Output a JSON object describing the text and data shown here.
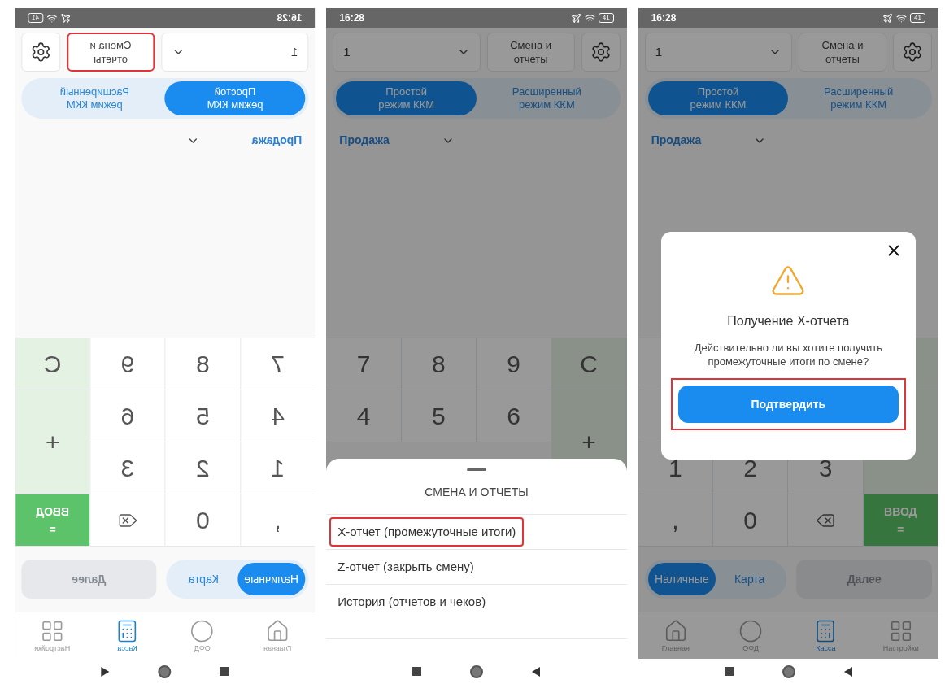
{
  "screens": [
    {
      "mirrored": true,
      "dimmed": false,
      "status_bar": {
        "time": "16:28",
        "battery": "41"
      },
      "shift_select": {
        "value": "1"
      },
      "shift_button": {
        "label": "Смена и отчеты",
        "highlighted": true
      },
      "modes": [
        {
          "label": "Расширенный режим ККМ",
          "selected": false
        },
        {
          "label": "Простой режим ККМ",
          "selected": true
        }
      ],
      "operation": "Продажа",
      "keypad": [
        {
          "kind": "clear",
          "label": "C"
        },
        {
          "kind": "digit",
          "label": "9"
        },
        {
          "kind": "digit",
          "label": "8"
        },
        {
          "kind": "digit",
          "label": "7"
        },
        {
          "kind": "plus",
          "label": "+"
        },
        {
          "kind": "digit",
          "label": "6"
        },
        {
          "kind": "digit",
          "label": "5"
        },
        {
          "kind": "digit",
          "label": "4"
        },
        {
          "kind": "digit",
          "label": "3"
        },
        {
          "kind": "digit",
          "label": "2"
        },
        {
          "kind": "digit",
          "label": "1"
        },
        {
          "kind": "enter",
          "label": "ВВОД",
          "sublabel": "="
        },
        {
          "kind": "backspace"
        },
        {
          "kind": "digit",
          "label": "0"
        },
        {
          "kind": "digit",
          "label": ","
        }
      ],
      "payments": [
        {
          "label": "Карта",
          "selected": false
        },
        {
          "label": "Наличные",
          "selected": true
        }
      ],
      "next_button": {
        "label": "Далее",
        "disabled": true
      },
      "nav": [
        {
          "kind": "grid",
          "label": "Настройки",
          "selected": false
        },
        {
          "kind": "calculator",
          "label": "Касса",
          "selected": true
        },
        {
          "kind": "circle",
          "label": "ОФД",
          "selected": false
        },
        {
          "kind": "home",
          "label": "Главная",
          "selected": false
        }
      ]
    },
    {
      "mirrored": false,
      "dimmed": true,
      "status_bar": {
        "time": "16:28",
        "battery": "41"
      },
      "shift_select": {
        "value": "1"
      },
      "shift_button": {
        "label": "Смена и отчеты",
        "highlighted": false
      },
      "modes": [
        {
          "label": "Простой режим ККМ",
          "selected": true
        },
        {
          "label": "Расширенный режим ККМ",
          "selected": false
        }
      ],
      "operation": "Продажа",
      "keypad": [
        {
          "kind": "digit",
          "label": "7"
        },
        {
          "kind": "digit",
          "label": "8"
        },
        {
          "kind": "digit",
          "label": "9"
        },
        {
          "kind": "clear",
          "label": "C"
        },
        {
          "kind": "digit",
          "label": "4"
        },
        {
          "kind": "digit",
          "label": "5"
        },
        {
          "kind": "digit",
          "label": "6"
        },
        {
          "kind": "plus",
          "label": "+"
        }
      ],
      "sheet": {
        "title": "СМЕНА И ОТЧЕТЫ",
        "items": [
          {
            "label": "X-отчет (промежуточные итоги)",
            "highlighted": true
          },
          {
            "label": "Z-отчет (закрыть смену)",
            "highlighted": false
          },
          {
            "label": "История (отчетов и чеков)",
            "highlighted": false
          }
        ]
      }
    },
    {
      "mirrored": false,
      "dimmed": true,
      "status_bar": {
        "time": "16:28",
        "battery": "41"
      },
      "shift_select": {
        "value": "1"
      },
      "shift_button": {
        "label": "Смена и отчеты",
        "highlighted": false
      },
      "modes": [
        {
          "label": "Простой режим ККМ",
          "selected": true
        },
        {
          "label": "Расширенный режим ККМ",
          "selected": false
        }
      ],
      "operation": "Продажа",
      "keypad": [
        {
          "kind": "blank"
        },
        {
          "kind": "blank"
        },
        {
          "kind": "blank"
        },
        {
          "kind": "blank_tint"
        },
        {
          "kind": "blank"
        },
        {
          "kind": "blank"
        },
        {
          "kind": "blank"
        },
        {
          "kind": "blank_tint_tall"
        },
        {
          "kind": "digit",
          "label": "1"
        },
        {
          "kind": "digit",
          "label": "2"
        },
        {
          "kind": "digit",
          "label": "3"
        },
        {
          "kind": "digit",
          "label": ","
        },
        {
          "kind": "digit",
          "label": "0"
        },
        {
          "kind": "backspace"
        },
        {
          "kind": "enter",
          "label": "ВВОД",
          "sublabel": "="
        }
      ],
      "payments": [
        {
          "label": "Наличные",
          "selected": true
        },
        {
          "label": "Карта",
          "selected": false
        }
      ],
      "next_button": {
        "label": "Далее",
        "disabled": true
      },
      "nav": [
        {
          "kind": "home",
          "label": "Главная",
          "selected": false
        },
        {
          "kind": "circle",
          "label": "ОФД",
          "selected": false
        },
        {
          "kind": "calculator",
          "label": "Касса",
          "selected": true
        },
        {
          "kind": "grid",
          "label": "Настройки",
          "selected": false
        }
      ],
      "dialog": {
        "title": "Получение X-отчета",
        "message": "Действительно ли вы хотите получить промежуточные итоги по смене?",
        "confirm": {
          "label": "Подтвердить",
          "highlighted": true
        }
      }
    }
  ]
}
